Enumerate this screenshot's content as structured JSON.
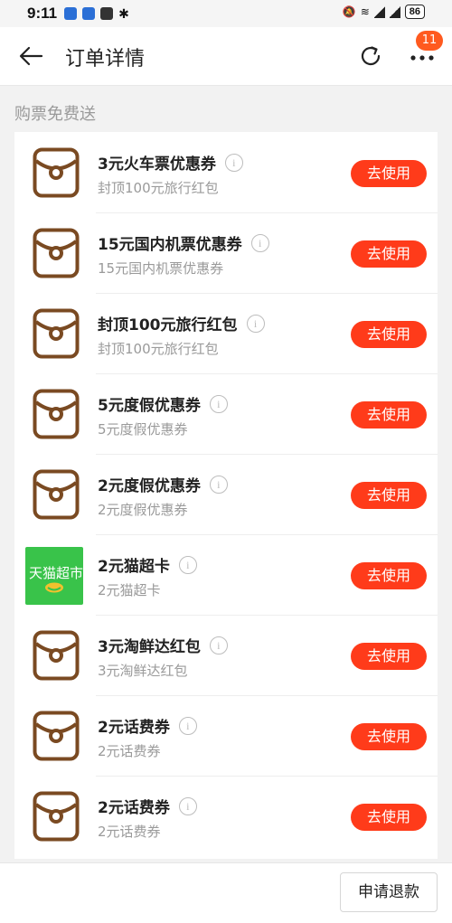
{
  "status_bar": {
    "time": "9:11",
    "battery": "86"
  },
  "header": {
    "title": "订单详情",
    "badge": "11"
  },
  "section": {
    "title": "购票免费送"
  },
  "coupons": [
    {
      "title": "3元火车票优惠券",
      "subtitle": "封顶100元旅行红包",
      "button": "去使用",
      "icon": "coupon-icon"
    },
    {
      "title": "15元国内机票优惠券",
      "subtitle": "15元国内机票优惠券",
      "button": "去使用",
      "icon": "coupon-icon"
    },
    {
      "title": "封顶100元旅行红包",
      "subtitle": "封顶100元旅行红包",
      "button": "去使用",
      "icon": "coupon-icon"
    },
    {
      "title": "5元度假优惠券",
      "subtitle": "5元度假优惠券",
      "button": "去使用",
      "icon": "coupon-icon"
    },
    {
      "title": "2元度假优惠券",
      "subtitle": "2元度假优惠券",
      "button": "去使用",
      "icon": "coupon-icon"
    },
    {
      "title": "2元猫超卡",
      "subtitle": "2元猫超卡",
      "button": "去使用",
      "icon": "tmall-supermarket-logo",
      "logo_text": "天猫超市"
    },
    {
      "title": "3元淘鲜达红包",
      "subtitle": "3元淘鲜达红包",
      "button": "去使用",
      "icon": "coupon-icon"
    },
    {
      "title": "2元话费券",
      "subtitle": "2元话费券",
      "button": "去使用",
      "icon": "coupon-icon"
    },
    {
      "title": "2元话费券",
      "subtitle": "2元话费券",
      "button": "去使用",
      "icon": "coupon-icon"
    }
  ],
  "footer": {
    "refund_label": "申请退款"
  },
  "colors": {
    "accent": "#ff3b1a",
    "badge": "#ff5a1f",
    "coupon_icon": "#7a4a22",
    "tmall_green": "#39c34a"
  }
}
